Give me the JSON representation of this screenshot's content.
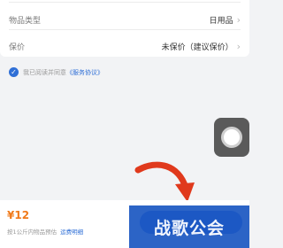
{
  "form": {
    "item_type_label": "物品类型",
    "item_type_value": "日用品",
    "insurance_label": "保价",
    "insurance_value": "未保价（建议保价）"
  },
  "agreement": {
    "prefix": "我已阅读并同意",
    "link": "《服务协议》"
  },
  "footer": {
    "price": "¥12",
    "note": "按1公斤内物品预估",
    "fee_detail_link": "运费明细"
  },
  "watermark": {
    "text": "战歌公会"
  },
  "colors": {
    "accent": "#2f6fd6",
    "price": "#f07a1a",
    "arrow": "#e0391c"
  },
  "icons": [
    "chevron-right-icon",
    "checkmark-icon",
    "assistive-touch-icon",
    "arrow-icon"
  ]
}
